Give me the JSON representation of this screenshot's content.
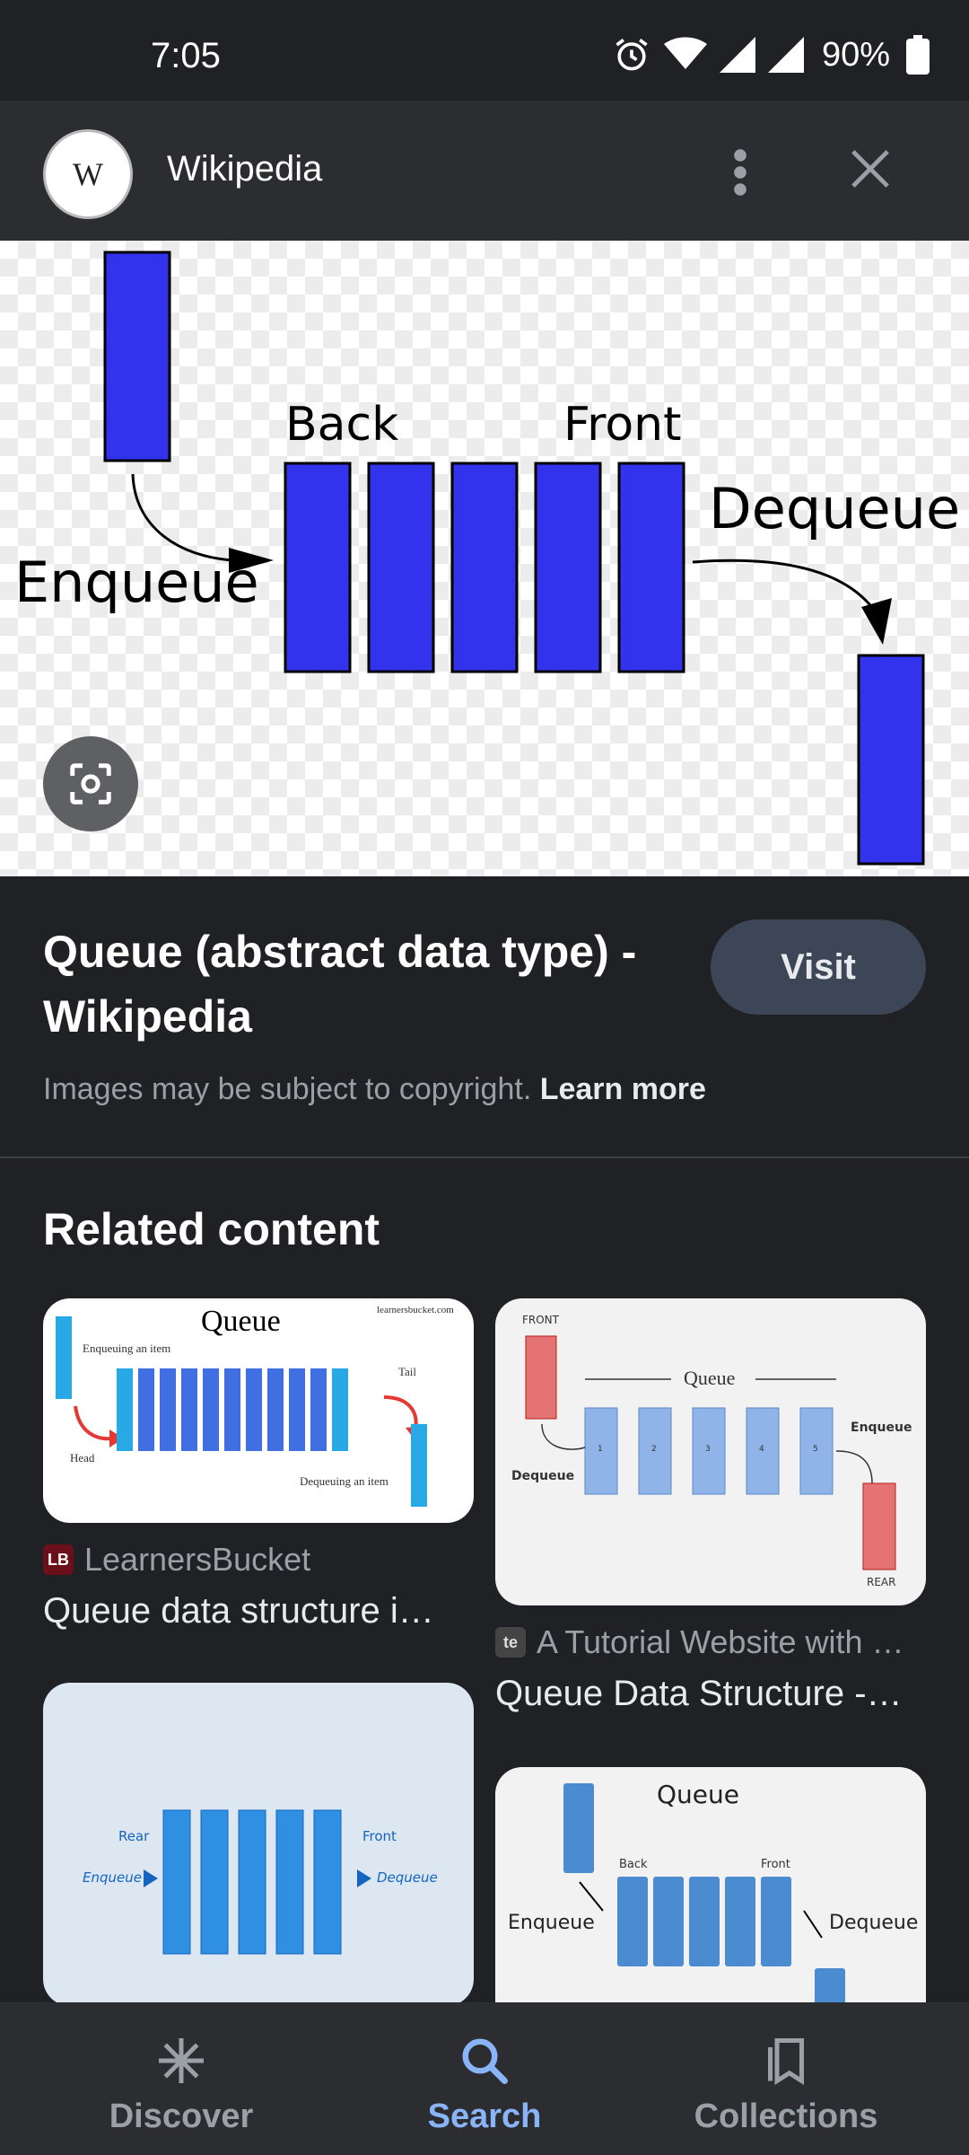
{
  "status_bar": {
    "time": "7:05",
    "battery": "90%"
  },
  "header": {
    "site_name": "Wikipedia",
    "logo_letter": "W"
  },
  "hero_image": {
    "labels": {
      "back": "Back",
      "front": "Front",
      "enqueue": "Enqueue",
      "dequeue": "Dequeue"
    }
  },
  "result": {
    "title": "Queue (abstract data type) - Wikipedia",
    "visit_label": "Visit",
    "copyright_text": "Images may be subject to copyright.",
    "learn_more": "Learn more"
  },
  "related": {
    "heading": "Related content",
    "items": [
      {
        "source": "LearnersBucket",
        "favicon_text": "LB",
        "title": "Queue data structure i…",
        "thumb": {
          "heading": "Queue",
          "watermark": "learnersbucket.com",
          "enqueuing": "Enqueuing an item",
          "head": "Head",
          "tail": "Tail",
          "dequeuing": "Dequeuing an item"
        }
      },
      {
        "source": "A Tutorial Website with …",
        "favicon_text": "te",
        "title": "Queue Data Structure -…",
        "thumb": {
          "front": "FRONT",
          "queue": "Queue",
          "enqueue": "Enqueue",
          "dequeue": "Dequeue",
          "rear": "REAR",
          "nums": [
            "1",
            "2",
            "3",
            "4",
            "5"
          ]
        }
      },
      {
        "thumb": {
          "rear": "Rear",
          "front": "Front",
          "enqueue": "Enqueue",
          "dequeue": "Dequeue"
        }
      },
      {
        "thumb": {
          "heading": "Queue",
          "back": "Back",
          "front": "Front",
          "enqueue": "Enqueue",
          "dequeue": "Dequeue"
        }
      }
    ]
  },
  "bottom_nav": {
    "items": [
      {
        "label": "Discover",
        "icon": "asterisk-icon"
      },
      {
        "label": "Search",
        "icon": "search-icon",
        "active": true
      },
      {
        "label": "Collections",
        "icon": "collections-icon"
      }
    ]
  },
  "colors": {
    "accent": "#8ab4f8",
    "queue_block": "#3333ee"
  }
}
